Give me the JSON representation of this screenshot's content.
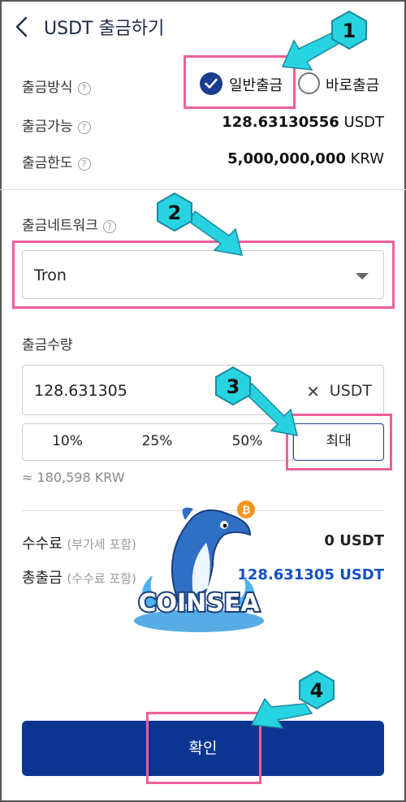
{
  "header": {
    "title": "USDT 출금하기"
  },
  "method": {
    "label": "출금방식",
    "options": [
      {
        "label": "일반출금",
        "checked": true
      },
      {
        "label": "바로출금",
        "checked": false
      }
    ]
  },
  "available": {
    "label": "출금가능",
    "amount": "128.63130556",
    "unit": "USDT"
  },
  "limit": {
    "label": "출금한도",
    "amount": "5,000,000,000",
    "unit": "KRW"
  },
  "network": {
    "label": "출금네트워크",
    "selected": "Tron"
  },
  "quantity": {
    "label": "출금수량",
    "value": "128.631305",
    "clear_icon": "✕",
    "unit": "USDT",
    "percents": [
      "10%",
      "25%",
      "50%",
      "최대"
    ],
    "krw_estimate": "≈ 180,598 KRW"
  },
  "fee": {
    "label": "수수료",
    "note": "(부가세 포함)",
    "value": "0 USDT"
  },
  "total": {
    "label": "총출금",
    "note": "(수수료 포함)",
    "value": "128.631305 USDT"
  },
  "confirm_label": "확인",
  "annotations": [
    "1",
    "2",
    "3",
    "4"
  ],
  "watermark": "COINSEA",
  "colors": {
    "accent": "#0c3591",
    "highlight": "#ee5f9b",
    "badge": "#2ad1e0",
    "total": "#1450c8"
  }
}
